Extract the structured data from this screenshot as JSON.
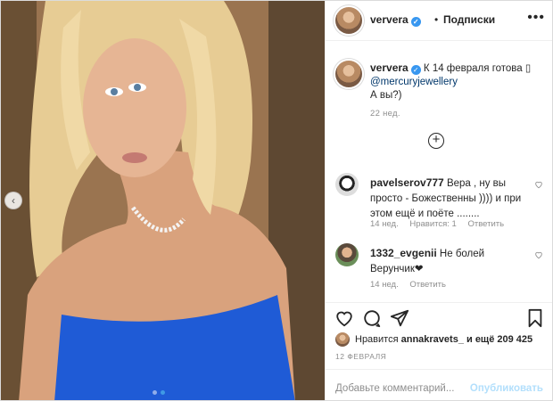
{
  "post": {
    "username": "ververa",
    "verified": true,
    "separator": "•",
    "follow_label": "Подписки",
    "more_icon": "more-horizontal-icon"
  },
  "caption": {
    "username": "ververa",
    "text_before": "К 14 февраля готова ",
    "mention": "@mercuryjewellery",
    "text_after": "А вы?)",
    "time": "22 нед."
  },
  "load_more": "+",
  "comments": [
    {
      "username": "pavelserov777",
      "text": "Вера , ну вы просто - Божественны )))) и при этом ещё и поёте ........",
      "time": "14 нед.",
      "likes": "Нравится: 1",
      "reply": "Ответить"
    },
    {
      "username": "1332_evgenii",
      "text": "Не болей Верунчик❤",
      "time": "14 нед.",
      "reply": "Ответить"
    }
  ],
  "likes": {
    "prefix": "Нравится",
    "user": "annakravets_",
    "suffix": "и ещё 209 425"
  },
  "date": "12 ФЕВРАЛЯ",
  "comment_box": {
    "placeholder": "Добавьте комментарий...",
    "publish": "Опубликовать"
  },
  "carousel": {
    "slides": 2,
    "active": 2
  },
  "colors": {
    "accent": "#3897f0",
    "text": "#262626",
    "muted": "#8e8e8e",
    "dress": "#1f5bd6"
  }
}
